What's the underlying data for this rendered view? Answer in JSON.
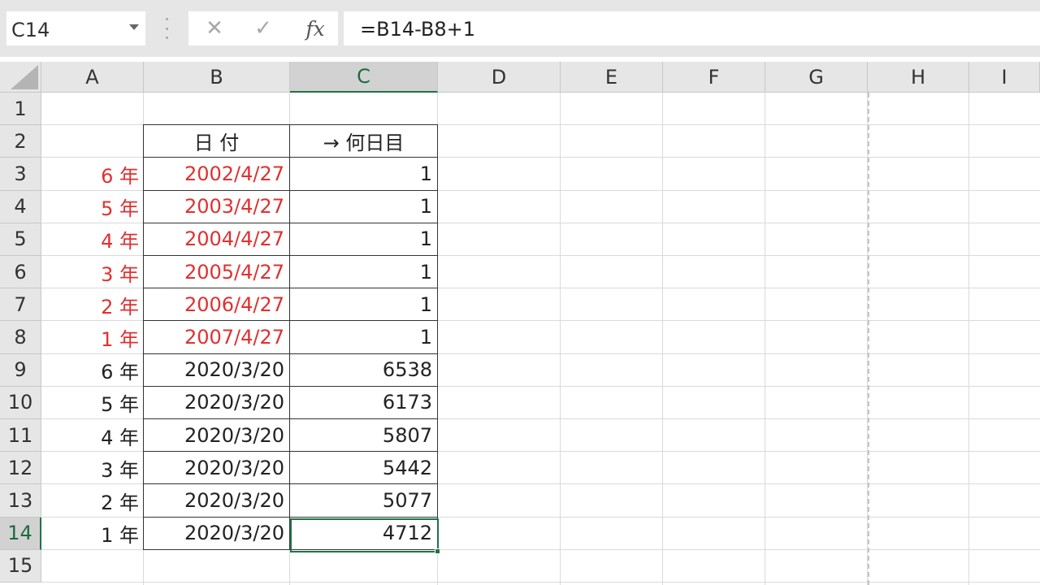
{
  "name_box": {
    "value": "C14"
  },
  "formula_bar": {
    "cancel_symbol": "✕",
    "enter_symbol": "✓",
    "fx_label": "fx",
    "formula": "=B14-B8+1"
  },
  "columns": [
    "A",
    "B",
    "C",
    "D",
    "E",
    "F",
    "G",
    "H",
    "I"
  ],
  "selected_column": "C",
  "rows": [
    "1",
    "2",
    "3",
    "4",
    "5",
    "6",
    "7",
    "8",
    "9",
    "10",
    "11",
    "12",
    "13",
    "14",
    "15"
  ],
  "selected_row": "14",
  "table": {
    "header_b": "日 付",
    "header_c": "→ 何日目",
    "data": [
      {
        "a": "6 年",
        "b": "2002/4/27",
        "c": "1"
      },
      {
        "a": "5 年",
        "b": "2003/4/27",
        "c": "1"
      },
      {
        "a": "4 年",
        "b": "2004/4/27",
        "c": "1"
      },
      {
        "a": "3 年",
        "b": "2005/4/27",
        "c": "1"
      },
      {
        "a": "2 年",
        "b": "2006/4/27",
        "c": "1"
      },
      {
        "a": "1 年",
        "b": "2007/4/27",
        "c": "1"
      },
      {
        "a": "6 年",
        "b": "2020/3/20",
        "c": "6538"
      },
      {
        "a": "5 年",
        "b": "2020/3/20",
        "c": "6173"
      },
      {
        "a": "4 年",
        "b": "2020/3/20",
        "c": "5807"
      },
      {
        "a": "3 年",
        "b": "2020/3/20",
        "c": "5442"
      },
      {
        "a": "2 年",
        "b": "2020/3/20",
        "c": "5077"
      },
      {
        "a": "1 年",
        "b": "2020/3/20",
        "c": "4712"
      }
    ]
  },
  "colors": {
    "highlight_text": "#e03030",
    "selection_accent": "#217346"
  }
}
